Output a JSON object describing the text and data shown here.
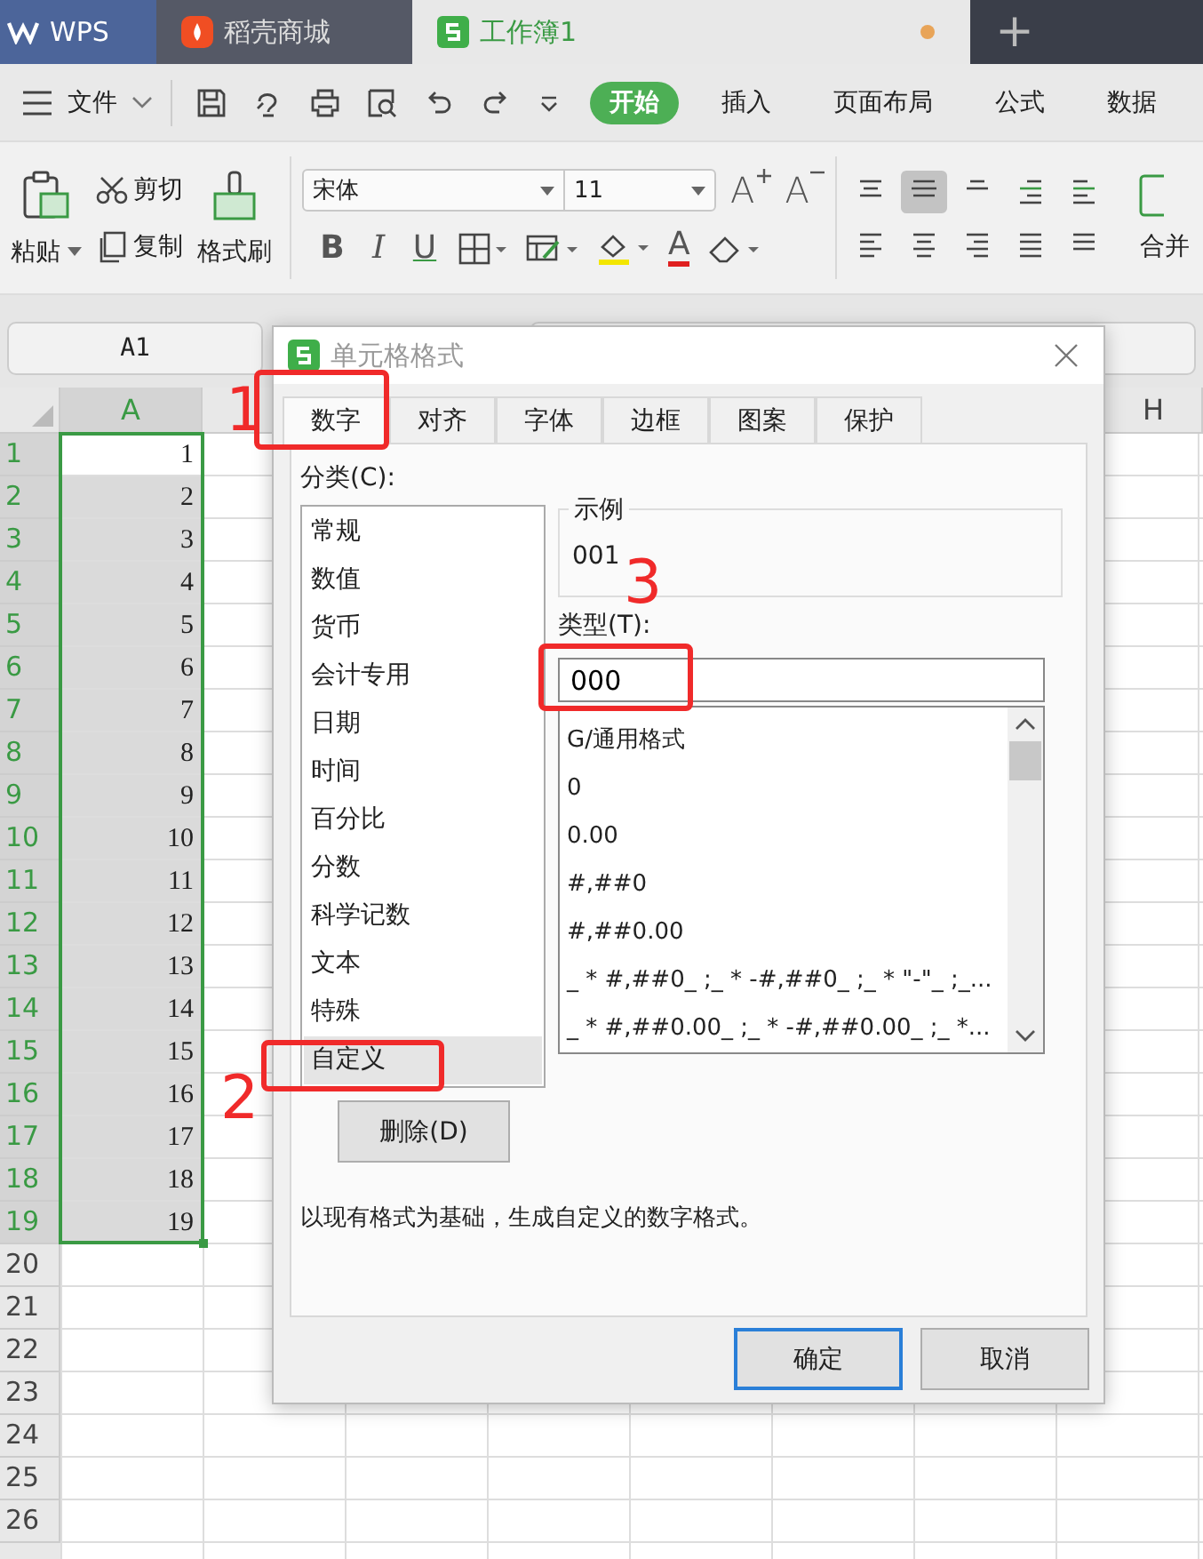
{
  "app_tabs": [
    {
      "label": "WPS",
      "kind": "home",
      "selected": false
    },
    {
      "label": "稻壳商城",
      "kind": "store",
      "selected": false
    },
    {
      "label": "工作簿1",
      "kind": "sheet",
      "selected": true
    }
  ],
  "new_tab": "+",
  "menu": {
    "file": "文件",
    "items": [
      {
        "label": "开始",
        "selected": true
      },
      {
        "label": "插入",
        "selected": false
      },
      {
        "label": "页面布局",
        "selected": false
      },
      {
        "label": "公式",
        "selected": false
      },
      {
        "label": "数据",
        "selected": false
      }
    ]
  },
  "ribbon": {
    "paste": "粘贴",
    "cut": "剪切",
    "copy": "复制",
    "format_painter": "格式刷",
    "font_name": "宋体",
    "font_size": "11",
    "grow_font": "A",
    "shrink_font": "A",
    "bold": "B",
    "italic": "I",
    "underline": "U",
    "font_color": "A",
    "merge": "合并",
    "align_buttons": [
      {
        "selected": false
      },
      {
        "selected": true
      },
      {
        "selected": false
      },
      {
        "selected": false
      },
      {
        "selected": false
      },
      {
        "selected": false
      },
      {
        "selected": false
      },
      {
        "selected": false
      },
      {
        "selected": false
      },
      {
        "selected": false
      }
    ]
  },
  "name_box": "A1",
  "sheet": {
    "column_header": "A",
    "right_column_header": "H",
    "rows": [
      {
        "number": "1",
        "value": "1",
        "selected": true
      },
      {
        "number": "2",
        "value": "2",
        "selected": true
      },
      {
        "number": "3",
        "value": "3",
        "selected": true
      },
      {
        "number": "4",
        "value": "4",
        "selected": true
      },
      {
        "number": "5",
        "value": "5",
        "selected": true
      },
      {
        "number": "6",
        "value": "6",
        "selected": true
      },
      {
        "number": "7",
        "value": "7",
        "selected": true
      },
      {
        "number": "8",
        "value": "8",
        "selected": true
      },
      {
        "number": "9",
        "value": "9",
        "selected": true
      },
      {
        "number": "10",
        "value": "10",
        "selected": true
      },
      {
        "number": "11",
        "value": "11",
        "selected": true
      },
      {
        "number": "12",
        "value": "12",
        "selected": true
      },
      {
        "number": "13",
        "value": "13",
        "selected": true
      },
      {
        "number": "14",
        "value": "14",
        "selected": true
      },
      {
        "number": "15",
        "value": "15",
        "selected": true
      },
      {
        "number": "16",
        "value": "16",
        "selected": true
      },
      {
        "number": "17",
        "value": "17",
        "selected": true
      },
      {
        "number": "18",
        "value": "18",
        "selected": true
      },
      {
        "number": "19",
        "value": "19",
        "selected": true
      },
      {
        "number": "20",
        "selected": false
      },
      {
        "number": "21",
        "selected": false
      },
      {
        "number": "22",
        "selected": false
      },
      {
        "number": "23",
        "selected": false
      },
      {
        "number": "24",
        "selected": false
      },
      {
        "number": "25",
        "selected": false
      },
      {
        "number": "26",
        "selected": false
      }
    ]
  },
  "dialog": {
    "title": "单元格格式",
    "tabs": [
      {
        "label": "数字",
        "selected": true
      },
      {
        "label": "对齐",
        "selected": false
      },
      {
        "label": "字体",
        "selected": false
      },
      {
        "label": "边框",
        "selected": false
      },
      {
        "label": "图案",
        "selected": false
      },
      {
        "label": "保护",
        "selected": false
      }
    ],
    "category_label": "分类(C):",
    "categories": [
      {
        "label": "常规",
        "selected": false
      },
      {
        "label": "数值",
        "selected": false
      },
      {
        "label": "货币",
        "selected": false
      },
      {
        "label": "会计专用",
        "selected": false
      },
      {
        "label": "日期",
        "selected": false
      },
      {
        "label": "时间",
        "selected": false
      },
      {
        "label": "百分比",
        "selected": false
      },
      {
        "label": "分数",
        "selected": false
      },
      {
        "label": "科学记数",
        "selected": false
      },
      {
        "label": "文本",
        "selected": false
      },
      {
        "label": "特殊",
        "selected": false
      },
      {
        "label": "自定义",
        "selected": true
      }
    ],
    "sample_label": "示例",
    "sample": "001",
    "type_label": "类型(T):",
    "type_value": "000",
    "formats": [
      "G/通用格式",
      "0",
      "0.00",
      "#,##0",
      "#,##0.00",
      "_ * #,##0_ ;_ * -#,##0_ ;_ * \"-\"_ ;_...",
      "_ * #,##0.00_ ;_ * -#,##0.00_ ;_ *..."
    ],
    "delete_button": "删除(D)",
    "description": "以现有格式为基础，生成自定义的数字格式。",
    "buttons": [
      {
        "label": "确定",
        "kind": "default"
      },
      {
        "label": "取消",
        "kind": "normal"
      }
    ]
  },
  "annotations": [
    {
      "label": "1"
    },
    {
      "label": "2"
    },
    {
      "label": "3"
    }
  ]
}
